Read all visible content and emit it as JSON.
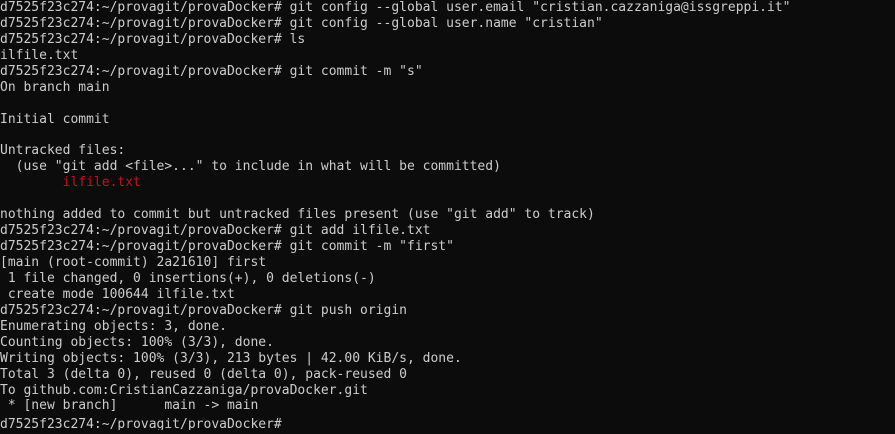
{
  "terminal": {
    "lines": [
      {
        "text": "d7525f23c274:~/provagit/provaDocker# git config --global user.email \"cristian.cazzaniga@issgreppi.it\"",
        "color": "#cccccc"
      },
      {
        "text": "d7525f23c274:~/provagit/provaDocker# git config --global user.name \"cristian\"",
        "color": "#cccccc"
      },
      {
        "text": "d7525f23c274:~/provagit/provaDocker# ls",
        "color": "#cccccc"
      },
      {
        "text": "ilfile.txt",
        "color": "#cccccc"
      },
      {
        "text": "d7525f23c274:~/provagit/provaDocker# git commit -m \"s\"",
        "color": "#cccccc"
      },
      {
        "text": "On branch main",
        "color": "#cccccc"
      },
      {
        "text": "",
        "color": "#cccccc"
      },
      {
        "text": "Initial commit",
        "color": "#cccccc"
      },
      {
        "text": "",
        "color": "#cccccc"
      },
      {
        "text": "Untracked files:",
        "color": "#cccccc"
      },
      {
        "text": "  (use \"git add <file>...\" to include in what will be committed)",
        "color": "#cccccc"
      },
      {
        "text": "        ilfile.txt",
        "color": "#c50f1f"
      },
      {
        "text": "",
        "color": "#cccccc"
      },
      {
        "text": "nothing added to commit but untracked files present (use \"git add\" to track)",
        "color": "#cccccc"
      },
      {
        "text": "d7525f23c274:~/provagit/provaDocker# git add ilfile.txt",
        "color": "#cccccc"
      },
      {
        "text": "d7525f23c274:~/provagit/provaDocker# git commit -m \"first\"",
        "color": "#cccccc"
      },
      {
        "text": "[main (root-commit) 2a21610] first",
        "color": "#cccccc"
      },
      {
        "text": " 1 file changed, 0 insertions(+), 0 deletions(-)",
        "color": "#cccccc"
      },
      {
        "text": " create mode 100644 ilfile.txt",
        "color": "#cccccc"
      },
      {
        "text": "d7525f23c274:~/provagit/provaDocker# git push origin",
        "color": "#cccccc"
      },
      {
        "text": "Enumerating objects: 3, done.",
        "color": "#cccccc"
      },
      {
        "text": "Counting objects: 100% (3/3), done.",
        "color": "#cccccc"
      },
      {
        "text": "Writing objects: 100% (3/3), 213 bytes | 42.00 KiB/s, done.",
        "color": "#cccccc"
      },
      {
        "text": "Total 3 (delta 0), reused 0 (delta 0), pack-reused 0",
        "color": "#cccccc"
      },
      {
        "text": "To github.com:CristianCazzaniga/provaDocker.git",
        "color": "#cccccc"
      },
      {
        "text": " * [new branch]      main -> main",
        "color": "#cccccc"
      },
      {
        "text": "d7525f23c274:~/provagit/provaDocker#",
        "color": "#cccccc"
      }
    ],
    "background": "#0c0c0c",
    "foreground": "#cccccc",
    "accent_red": "#c50f1f"
  }
}
